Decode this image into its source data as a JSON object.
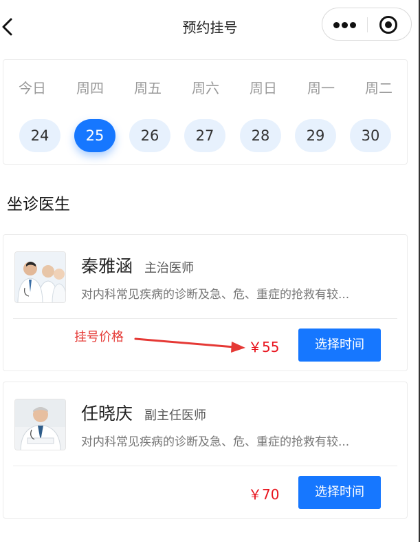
{
  "header": {
    "title": "预约挂号"
  },
  "dates": {
    "weekdays": [
      "今日",
      "周四",
      "周五",
      "周六",
      "周日",
      "周一",
      "周二"
    ],
    "days": [
      "24",
      "25",
      "26",
      "27",
      "28",
      "29",
      "30"
    ],
    "selected_day": "25"
  },
  "section": {
    "title": "坐诊医生"
  },
  "doctors": [
    {
      "name": "秦雅涵",
      "title": "主治医师",
      "desc": "对内科常见疾病的诊断及急、危、重症的抢救有较...",
      "price": "￥55",
      "button": "选择时间"
    },
    {
      "name": "任晓庆",
      "title": "副主任医师",
      "desc": "对内科常见疾病的诊断及急、危、重症的抢救有较...",
      "price": "￥70",
      "button": "选择时间"
    }
  ],
  "annotation": {
    "label": "挂号价格"
  },
  "colors": {
    "accent": "#1677ff",
    "price": "#e8141e",
    "annotation": "#e53935",
    "day_bg": "#e7f1fd"
  }
}
